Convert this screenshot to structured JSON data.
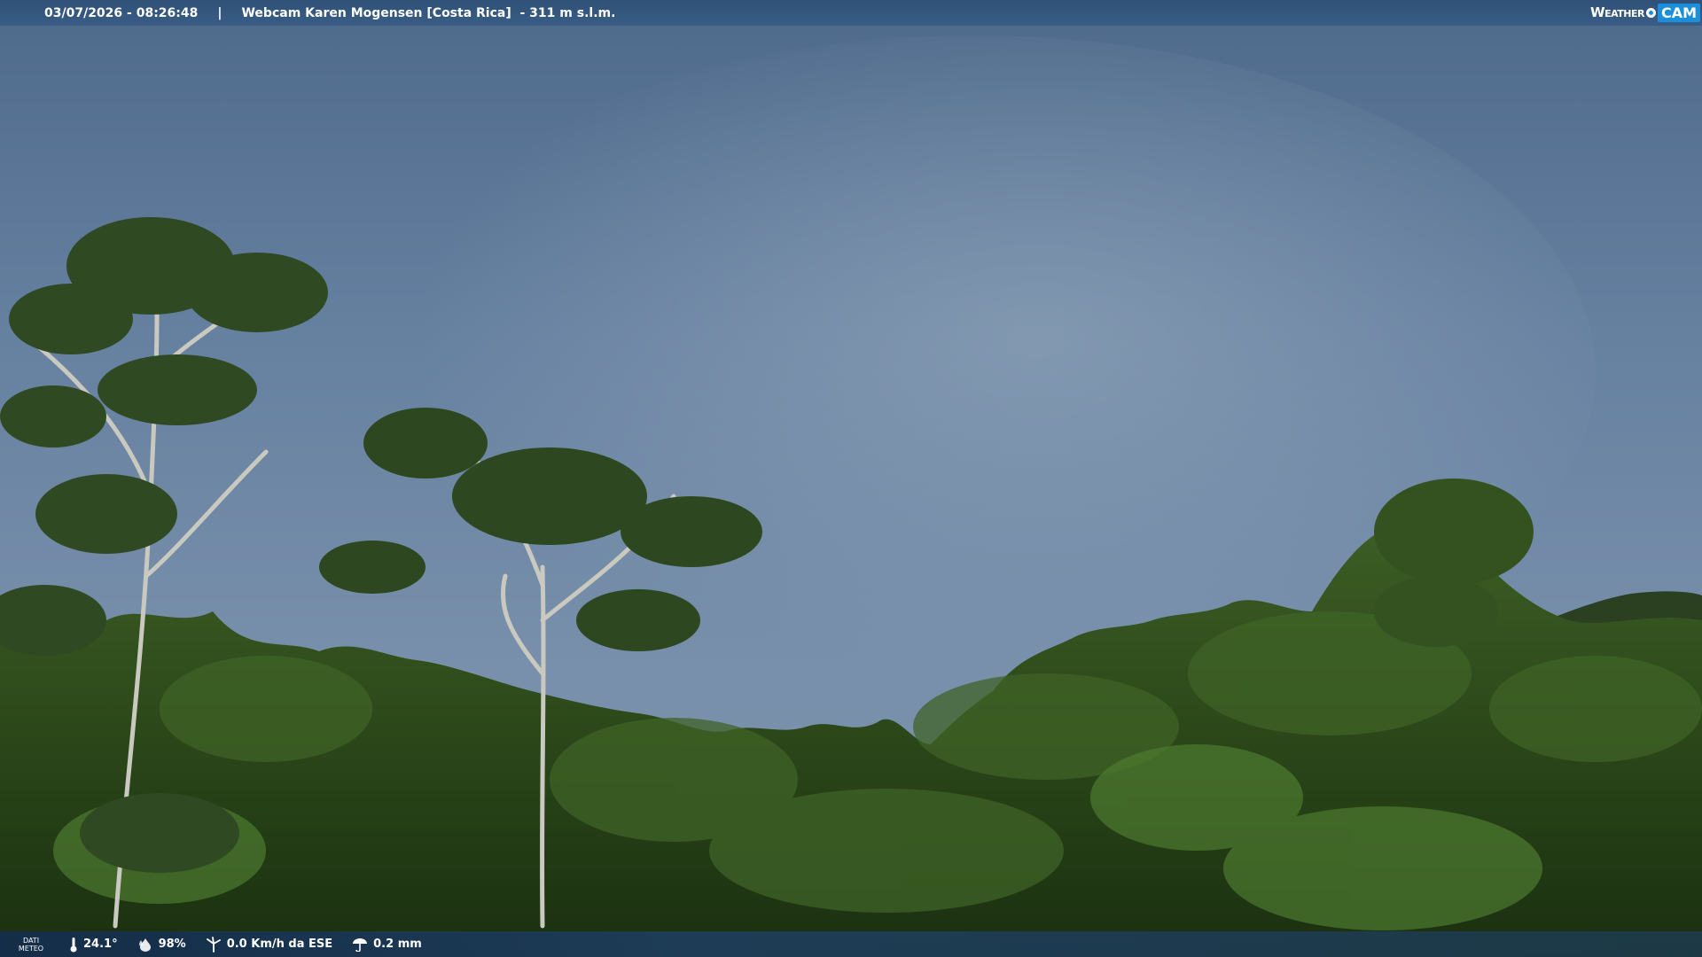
{
  "header": {
    "datetime": "03/07/2026 - 08:26:48",
    "separator": "|",
    "title": "Webcam Karen Mogensen [Costa Rica]  - 311 m s.l.m.",
    "logo_text_1": "Weather",
    "logo_text_2": "CAM"
  },
  "weather": {
    "label_line1": "DATI",
    "label_line2": "METEO",
    "temperature": "24.1°",
    "humidity": "98%",
    "wind": "0.0 Km/h da ESE",
    "rain": "0.2 mm",
    "icons": [
      "thermometer-icon",
      "humidity-drop-icon",
      "wind-icon",
      "rain-icon"
    ]
  },
  "colors": {
    "bar_blue": "#2f5178",
    "logo_blue": "#1b8fd9",
    "sky": "#6f88a4",
    "forest": "#2d4a1c"
  }
}
